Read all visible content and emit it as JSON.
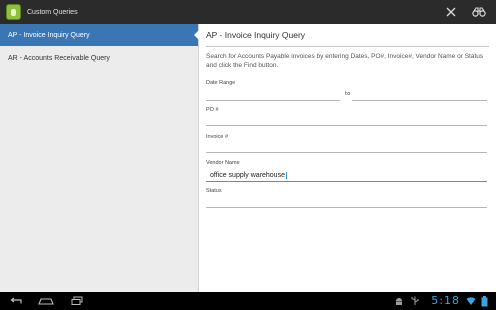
{
  "app": {
    "title": "Custom Queries"
  },
  "actionbar": {
    "icons": [
      "close-icon",
      "binoculars-icon"
    ]
  },
  "sidebar": {
    "items": [
      {
        "label": "AP - Invoice Inquiry Query",
        "selected": true
      },
      {
        "label": "AR - Accounts Receivable Query",
        "selected": false
      }
    ]
  },
  "form": {
    "title": "AP - Invoice Inquiry Query",
    "description": "Search for Accounts Payable invoices by entering Dates, PO#, Invoice#, Vendor Name or Status and click the Find button.",
    "date_range_label": "Date Range",
    "to_label": "to",
    "date_from_value": "",
    "date_to_value": "",
    "po_label": "PO #",
    "po_value": "",
    "invoice_label": "Invoice #",
    "invoice_value": "",
    "vendor_label": "Vendor Name",
    "vendor_value": "office supply warehouse",
    "status_label": "Status",
    "status_value": ""
  },
  "statusbar": {
    "clock": "5:18"
  },
  "colors": {
    "accent": "#3a75b4",
    "clock": "#3aa6e0"
  }
}
